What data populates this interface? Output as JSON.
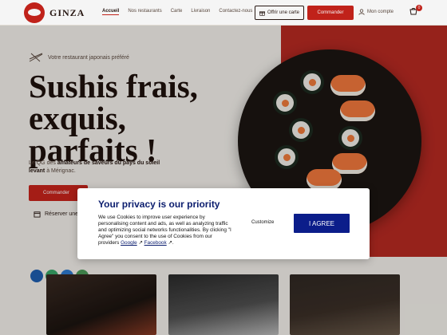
{
  "header": {
    "brand": "GINZA",
    "nav": [
      {
        "label": "Accueil",
        "active": true
      },
      {
        "label": "Nos restaurants",
        "active": false
      },
      {
        "label": "Carte",
        "active": false
      },
      {
        "label": "Livraison",
        "active": false
      },
      {
        "label": "Contactez-nous",
        "active": false
      }
    ],
    "gift_button": "Offrir une carte",
    "order_button": "Commander",
    "account_label": "Mon compte",
    "cart_count": "0"
  },
  "hero": {
    "tagline": "Votre restaurant japonais préféré",
    "headline_lines": [
      "Sushis frais,",
      "exquis,",
      "parfaits !"
    ],
    "intro_prefix": "Le QG des",
    "intro_bold": "amateurs de saveurs du pays du soleil levant",
    "intro_suffix": "à Mérignac.",
    "cta_button": "Commander",
    "reserve_link": "Réserver une table"
  },
  "consent": {
    "title": "Your privacy is our priority",
    "text": "We use Cookies to improve user experience by personalising content and ads, as well as analyzing traffic and optimizing social networks functionalities. By clicking \"I Agree\" you consent to the use of Cookies from our providers",
    "link_google": "Google",
    "link_separator": " ",
    "link_facebook": "Facebook",
    "text_end": ".",
    "customize_label": "Customize",
    "agree_label": "I AGREE"
  },
  "colors": {
    "brand_red": "#c8241c",
    "consent_blue": "#0b1d8a"
  },
  "icons": [
    "logo-icon",
    "gift-icon",
    "user-icon",
    "cart-icon",
    "chopsticks-icon",
    "calendar-icon",
    "external-link-icon"
  ]
}
